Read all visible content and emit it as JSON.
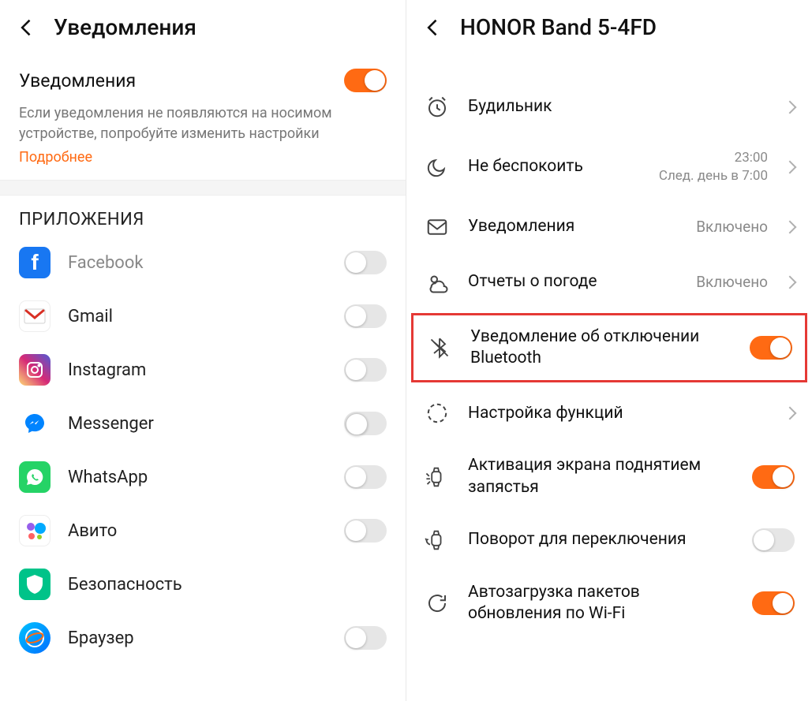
{
  "left": {
    "title": "Уведомления",
    "mainToggleLabel": "Уведомления",
    "mainToggleOn": true,
    "hint": "Если уведомления не появляются на носимом устройстве, попробуйте изменить настройки",
    "link": "Подробнее",
    "section": "ПРИЛОЖЕНИЯ",
    "apps": [
      {
        "name": "Facebook",
        "icon": "facebook",
        "on": false
      },
      {
        "name": "Gmail",
        "icon": "gmail",
        "on": false
      },
      {
        "name": "Instagram",
        "icon": "instagram",
        "on": false
      },
      {
        "name": "Messenger",
        "icon": "messenger",
        "on": false
      },
      {
        "name": "WhatsApp",
        "icon": "whatsapp",
        "on": false
      },
      {
        "name": "Авито",
        "icon": "avito",
        "on": false
      },
      {
        "name": "Безопасность",
        "icon": "shield",
        "on": null
      },
      {
        "name": "Браузер",
        "icon": "browser",
        "on": false
      }
    ]
  },
  "right": {
    "title": "HONOR Band 5-4FD",
    "items": [
      {
        "icon": "alarm",
        "title": "Будильник",
        "type": "nav"
      },
      {
        "icon": "moon",
        "title": "Не беспокоить",
        "type": "nav",
        "valueTop": "23:00",
        "valueBottom": "След. день в 7:00"
      },
      {
        "icon": "mail",
        "title": "Уведомления",
        "type": "nav",
        "value": "Включено"
      },
      {
        "icon": "weather",
        "title": "Отчеты о погоде",
        "type": "nav",
        "value": "Включено"
      },
      {
        "icon": "bluetooth",
        "title": "Уведомление об отключении Bluetooth",
        "type": "toggle",
        "on": true,
        "highlight": true
      },
      {
        "icon": "func",
        "title": "Настройка функций",
        "type": "nav"
      },
      {
        "icon": "wrist",
        "title": "Активация экрана поднятием запястья",
        "type": "toggle",
        "on": true
      },
      {
        "icon": "rotate",
        "title": "Поворот для переключения",
        "type": "toggle",
        "on": false
      },
      {
        "icon": "refresh",
        "title": "Автозагрузка пакетов обновления по Wi-Fi",
        "type": "toggle",
        "on": true
      }
    ]
  }
}
